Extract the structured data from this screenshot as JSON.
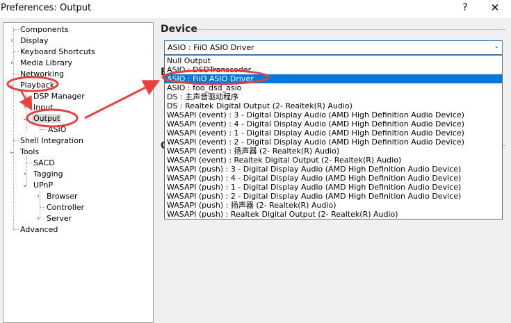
{
  "window": {
    "title": "Preferences: Output",
    "help_glyph": "?",
    "close_glyph": "✕"
  },
  "tree": {
    "expander_collapsed": "›",
    "expander_expanded": "⌄",
    "items": [
      {
        "id": "components",
        "label": "Components"
      },
      {
        "id": "display",
        "label": "Display"
      },
      {
        "id": "keyboard-shortcuts",
        "label": "Keyboard Shortcuts"
      },
      {
        "id": "media-library",
        "label": "Media Library"
      },
      {
        "id": "networking",
        "label": "Networking"
      },
      {
        "id": "playback",
        "label": "Playback"
      },
      {
        "id": "dsp-manager",
        "label": "DSP Manager"
      },
      {
        "id": "input",
        "label": "Input"
      },
      {
        "id": "output",
        "label": "Output"
      },
      {
        "id": "asio",
        "label": "ASIO"
      },
      {
        "id": "shell-integration",
        "label": "Shell Integration"
      },
      {
        "id": "tools",
        "label": "Tools"
      },
      {
        "id": "sacd",
        "label": "SACD"
      },
      {
        "id": "tagging",
        "label": "Tagging"
      },
      {
        "id": "upnp",
        "label": "UPnP"
      },
      {
        "id": "browser",
        "label": "Browser"
      },
      {
        "id": "controller",
        "label": "Controller"
      },
      {
        "id": "server",
        "label": "Server"
      },
      {
        "id": "advanced",
        "label": "Advanced"
      }
    ]
  },
  "device": {
    "section_title": "Device",
    "selected": "ASIO : FiiO ASIO Driver",
    "dropdown_arrow": "⌄",
    "options": [
      "Null Output",
      "ASIO : DSDTranscoder",
      "ASIO : FiiO ASIO Driver",
      "ASIO : foo_dsd_asio",
      "DS : 主声音驱动程序",
      "DS : Realtek Digital Output (2- Realtek(R) Audio)",
      "WASAPI (event) : 3 - Digital Display Audio (AMD High Definition Audio Device)",
      "WASAPI (event) : 4 - Digital Display Audio (AMD High Definition Audio Device)",
      "WASAPI (event) : 1 - Digital Display Audio (AMD High Definition Audio Device)",
      "WASAPI (event) : 2 - Digital Display Audio (AMD High Definition Audio Device)",
      "WASAPI (event) : 扬声器 (2- Realtek(R) Audio)",
      "WASAPI (event) : Realtek Digital Output (2- Realtek(R) Audio)",
      "WASAPI (push) : 3 - Digital Display Audio (AMD High Definition Audio Device)",
      "WASAPI (push) : 4 - Digital Display Audio (AMD High Definition Audio Device)",
      "WASAPI (push) : 1 - Digital Display Audio (AMD High Definition Audio Device)",
      "WASAPI (push) : 2 - Digital Display Audio (AMD High Definition Audio Device)",
      "WASAPI (push) : 扬声器 (2- Realtek(R) Audio)",
      "WASAPI (push) : Realtek Digital Output (2- Realtek(R) Audio)"
    ]
  },
  "hidden_sections": {
    "buffer_initial": "B",
    "output_initial": "O"
  },
  "colors": {
    "annotation_red": "#e8403f",
    "selection_blue": "#0078d7"
  }
}
